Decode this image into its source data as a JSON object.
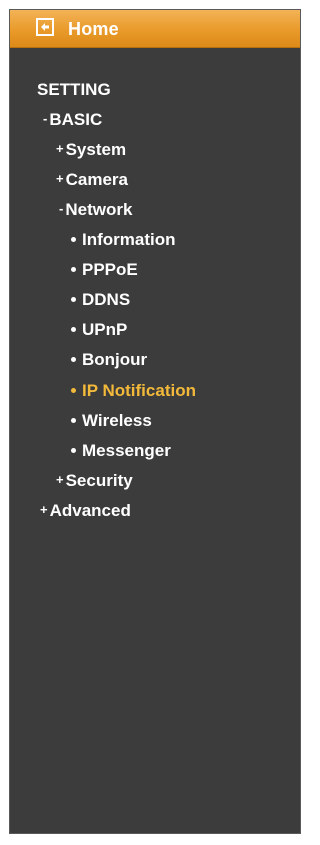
{
  "home": {
    "label": "Home",
    "icon": "back-arrow-icon"
  },
  "colors": {
    "panel_background": "#3c3c3c",
    "home_bar": "#e99a2a",
    "text": "#ffffff",
    "active_item": "#f2b93a"
  },
  "menu": {
    "setting_label": "SETTING",
    "basic": {
      "marker": "-",
      "label": "BASIC"
    },
    "system": {
      "marker": "+",
      "label": "System"
    },
    "camera": {
      "marker": "+",
      "label": "Camera"
    },
    "network": {
      "marker": "-",
      "label": "Network"
    },
    "network_items": [
      {
        "label": "Information"
      },
      {
        "label": "PPPoE"
      },
      {
        "label": "DDNS"
      },
      {
        "label": "UPnP"
      },
      {
        "label": "Bonjour"
      },
      {
        "label": "IP Notification",
        "active": true
      },
      {
        "label": "Wireless"
      },
      {
        "label": "Messenger"
      }
    ],
    "security": {
      "marker": "+",
      "label": "Security"
    },
    "advanced": {
      "marker": "+",
      "label": "Advanced"
    }
  }
}
